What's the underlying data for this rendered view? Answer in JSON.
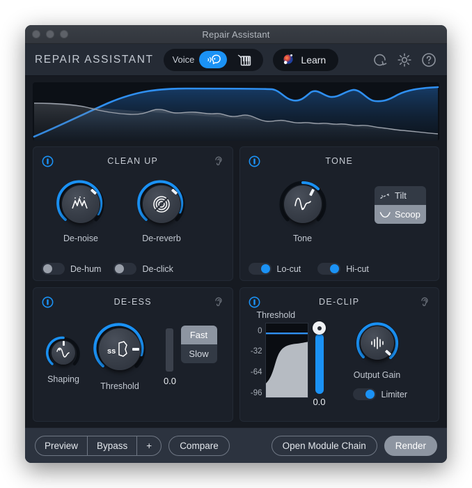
{
  "window": {
    "title": "Repair Assistant",
    "traffic_lights": [
      "close",
      "minimize",
      "zoom"
    ]
  },
  "header": {
    "brand": "REPAIR ASSISTANT",
    "mode_selector": {
      "label": "Voice",
      "options": [
        {
          "name": "voice",
          "icon": "voice-head-icon",
          "selected": true
        },
        {
          "name": "music",
          "icon": "piano-icon",
          "selected": false
        }
      ]
    },
    "learn_button": {
      "label": "Learn",
      "icon": "orb-icon"
    },
    "icons": [
      {
        "name": "reset-icon",
        "title": "Reset"
      },
      {
        "name": "gear-icon",
        "title": "Settings"
      },
      {
        "name": "help-icon",
        "title": "Help"
      }
    ]
  },
  "spectrum": {
    "name": "spectrum-display",
    "series": [
      {
        "name": "processed",
        "color": "#2f8ff0"
      },
      {
        "name": "original",
        "color": "#9aa0aa"
      }
    ]
  },
  "modules": {
    "clean_up": {
      "title": "CLEAN UP",
      "power": {
        "name": "power-icon",
        "enabled": true
      },
      "solo": {
        "name": "ear-icon",
        "enabled": false
      },
      "knobs": [
        {
          "name": "de-noise-knob",
          "label": "De-noise",
          "icon": "noise-peaks-icon",
          "value": 72
        },
        {
          "name": "de-reverb-knob",
          "label": "De-reverb",
          "icon": "reverb-target-icon",
          "value": 70
        }
      ],
      "toggles": [
        {
          "name": "de-hum-toggle",
          "label": "De-hum",
          "on": false
        },
        {
          "name": "de-click-toggle",
          "label": "De-click",
          "on": false
        }
      ]
    },
    "tone": {
      "title": "TONE",
      "power": {
        "name": "power-icon",
        "enabled": true
      },
      "knobs": [
        {
          "name": "tone-knob",
          "label": "Tone",
          "icon": "tone-curve-icon",
          "value": 52
        }
      ],
      "shape_selector": {
        "options": [
          {
            "label": "Tilt",
            "icon": "tilt-icon",
            "selected": false
          },
          {
            "label": "Scoop",
            "icon": "scoop-icon",
            "selected": true
          }
        ]
      },
      "toggles": [
        {
          "name": "lo-cut-toggle",
          "label": "Lo-cut",
          "on": true
        },
        {
          "name": "hi-cut-toggle",
          "label": "Hi-cut",
          "on": true
        }
      ]
    },
    "de_ess": {
      "title": "DE-ESS",
      "power": {
        "name": "power-icon",
        "enabled": true
      },
      "solo": {
        "name": "ear-icon",
        "enabled": false
      },
      "knobs": [
        {
          "name": "shaping-knob",
          "label": "Shaping",
          "icon": "shaping-wave-icon",
          "value": 50
        },
        {
          "name": "threshold-knob",
          "label": "Threshold",
          "icon": "sss-mouth-icon",
          "value": 75
        }
      ],
      "meter": {
        "name": "de-ess-meter",
        "value": "0.0"
      },
      "speed_selector": {
        "options": [
          {
            "label": "Fast",
            "selected": true
          },
          {
            "label": "Slow",
            "selected": false
          }
        ]
      }
    },
    "de_clip": {
      "title": "DE-CLIP",
      "power": {
        "name": "power-icon",
        "enabled": true
      },
      "solo": {
        "name": "ear-icon",
        "enabled": false
      },
      "threshold": {
        "label": "Threshold",
        "scale": [
          "0",
          "-32",
          "-64",
          "-96"
        ],
        "value": "0.0",
        "slider_percent": 88
      },
      "knobs": [
        {
          "name": "output-gain-knob",
          "label": "Output Gain",
          "icon": "levels-icon",
          "value": 92
        }
      ],
      "toggles": [
        {
          "name": "limiter-toggle",
          "label": "Limiter",
          "on": true
        }
      ]
    }
  },
  "footer": {
    "left_group": [
      "Preview",
      "Bypass",
      "+"
    ],
    "compare": "Compare",
    "open_module_chain": "Open Module Chain",
    "render": "Render"
  },
  "colors": {
    "accent": "#1b92f5",
    "panel": "#1b2029",
    "header": "#252b35",
    "footer": "#2c333f",
    "text": "#c8cdd5"
  }
}
